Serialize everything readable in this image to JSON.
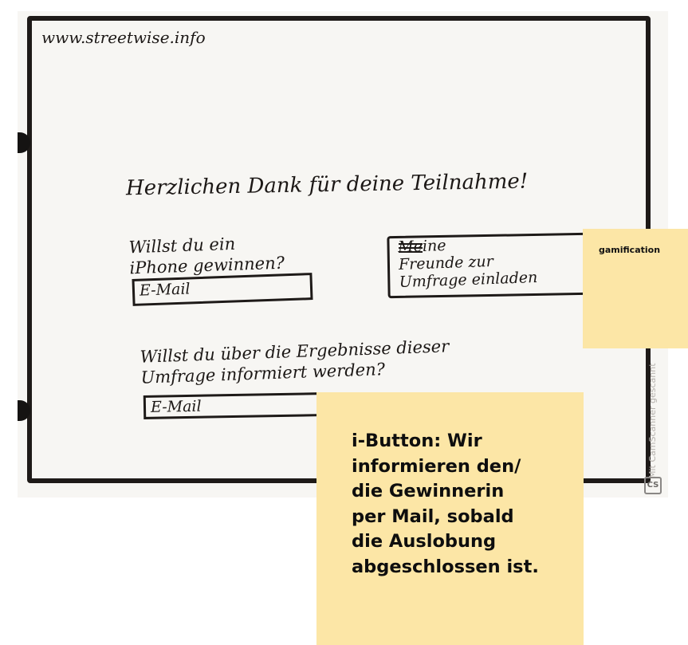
{
  "sketch": {
    "url": "www.streetwise.info",
    "thanks": "Herzlichen Dank für deine Teilnahme!",
    "iphone_question": "Willst du ein\niPhone gewinnen?",
    "email_field_1": "E-Mail",
    "invite_button": "Meine\nFreunde zur\nUmfrage einladen",
    "results_question": "Willst du über die Ergebnisse dieser\nUmfrage informiert werden?",
    "email_field_2": "E-Mail"
  },
  "notes": {
    "gamification": "gamification",
    "info_button": "i-Button: Wir\ninformieren den/\ndie Gewinnerin\nper Mail, sobald\ndie Auslobung\nabgeschlossen ist."
  },
  "watermark": "Mit CamScanner gescannt",
  "colors": {
    "sticky_note": "#fce6a6",
    "ink": "#1c1816"
  }
}
